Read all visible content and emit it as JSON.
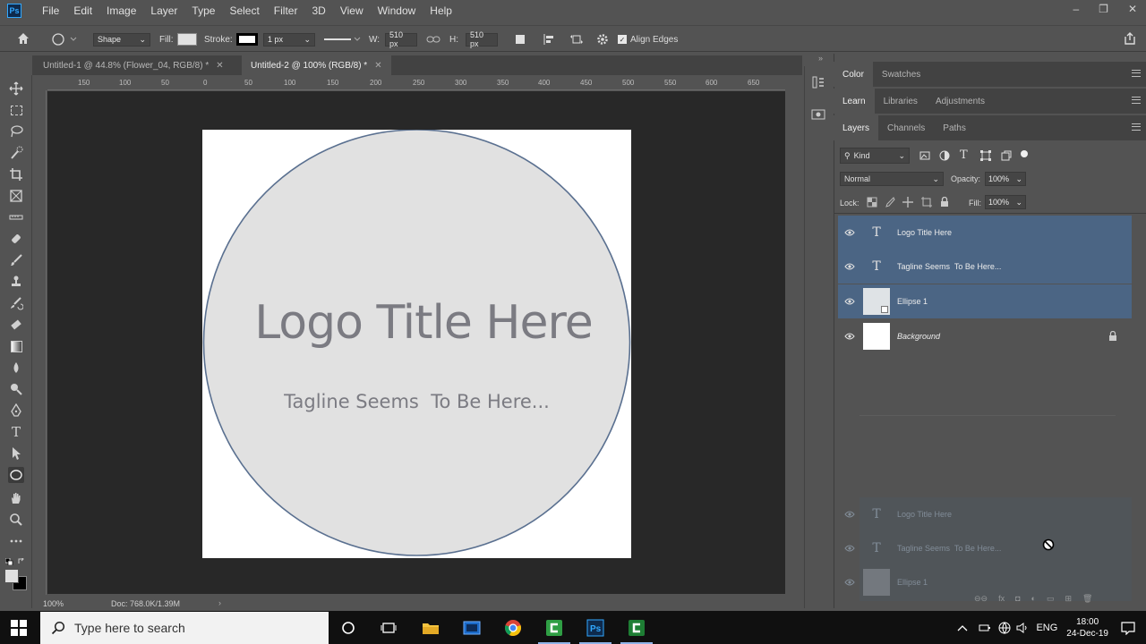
{
  "app": {
    "logo_text": "Ps",
    "menu": [
      "File",
      "Edit",
      "Image",
      "Layer",
      "Type",
      "Select",
      "Filter",
      "3D",
      "View",
      "Window",
      "Help"
    ],
    "window_controls": [
      "–",
      "❐",
      "✕"
    ]
  },
  "options_bar": {
    "mode": "Shape",
    "fill_label": "Fill:",
    "stroke_label": "Stroke:",
    "stroke_width": "1 px",
    "w_label": "W:",
    "w_value": "510 px",
    "h_label": "H:",
    "h_value": "510 px",
    "align_edges_label": "Align Edges",
    "align_edges_checked": true
  },
  "doc_tabs": [
    {
      "label": "Untitled-1 @ 44.8% (Flower_04, RGB/8) *",
      "active": false
    },
    {
      "label": "Untitled-2 @ 100% (RGB/8) *",
      "active": true
    }
  ],
  "ruler_ticks": [
    "150",
    "100",
    "50",
    "0",
    "50",
    "100",
    "150",
    "200",
    "250",
    "300",
    "350",
    "400",
    "450",
    "500",
    "550",
    "600",
    "650"
  ],
  "canvas": {
    "logo_title": "Logo Title Here",
    "tagline": "Tagline Seems  To Be Here...",
    "circle_fill": "#e1e1e1",
    "circle_stroke": "#5a7090",
    "text_color": "#7b7b82"
  },
  "status": {
    "zoom": "100%",
    "doc_info": "Doc: 768.0K/1.39M"
  },
  "panels": {
    "row1_tabs": [
      "Color",
      "Swatches"
    ],
    "row2_tabs": [
      "Learn",
      "Libraries",
      "Adjustments"
    ],
    "row3_tabs": [
      "Layers",
      "Channels",
      "Paths"
    ],
    "filter_kind": "Kind",
    "blend_mode": "Normal",
    "opacity_label": "Opacity:",
    "opacity_value": "100%",
    "lock_label": "Lock:",
    "fill_label": "Fill:",
    "fill_value": "100%",
    "layers": [
      {
        "name": "Logo Title Here",
        "type": "text",
        "selected": true
      },
      {
        "name": "Tagline Seems  To Be Here...",
        "type": "text",
        "selected": true
      },
      {
        "name": "Ellipse 1",
        "type": "shape",
        "selected": true
      },
      {
        "name": "Background",
        "type": "background",
        "selected": false,
        "locked": true
      }
    ],
    "drag_ghost_layers": [
      {
        "name": "Logo Title Here",
        "type": "text"
      },
      {
        "name": "Tagline Seems  To Be Here...",
        "type": "text"
      },
      {
        "name": "Ellipse 1",
        "type": "shape"
      }
    ]
  },
  "taskbar": {
    "search_placeholder": "Type here to search",
    "language": "ENG",
    "time": "18:00",
    "date": "24-Dec-19"
  }
}
